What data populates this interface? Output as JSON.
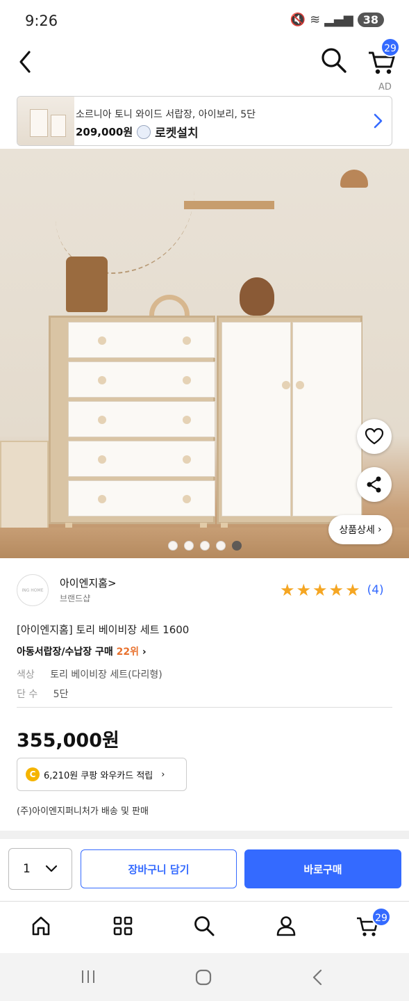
{
  "status": {
    "time": "9:26",
    "battery": "38"
  },
  "nav": {
    "cart_count": "29",
    "ad_label": "AD"
  },
  "ad_banner": {
    "title": "소르니아 토니 와이드 서랍장, 아이보리, 5단",
    "price": "209,000원",
    "badge": "로켓설치"
  },
  "gallery": {
    "count": 5,
    "active_index": 4,
    "detail_label": "상품상세"
  },
  "brand": {
    "logo_text": "ING HOME",
    "name": "아이엔지홈>",
    "sub": "브랜드샵"
  },
  "rating": {
    "stars": 5,
    "count": "(4)"
  },
  "product": {
    "title": "[아이엔지홈] 토리 베이비장 세트 1600",
    "category": "아동서랍장/수납장 구매",
    "rank": "22위",
    "options": [
      {
        "key": "색상",
        "value": "토리 베이비장 세트(다리형)"
      },
      {
        "key": "단 수",
        "value": "5단"
      }
    ],
    "price": "355,000원",
    "reward_coin": "C",
    "reward": "6,210원 쿠팡 와우카드 적립",
    "seller": "(주)아이엔지퍼니처가 배송 및 판매"
  },
  "purchase": {
    "qty": "1",
    "cart_label": "장바구니 담기",
    "buy_label": "바로구매"
  },
  "tabbar": {
    "cart_count": "29"
  },
  "colors": {
    "accent": "#346aff",
    "star": "#f5a623",
    "rank": "#e8712d"
  }
}
